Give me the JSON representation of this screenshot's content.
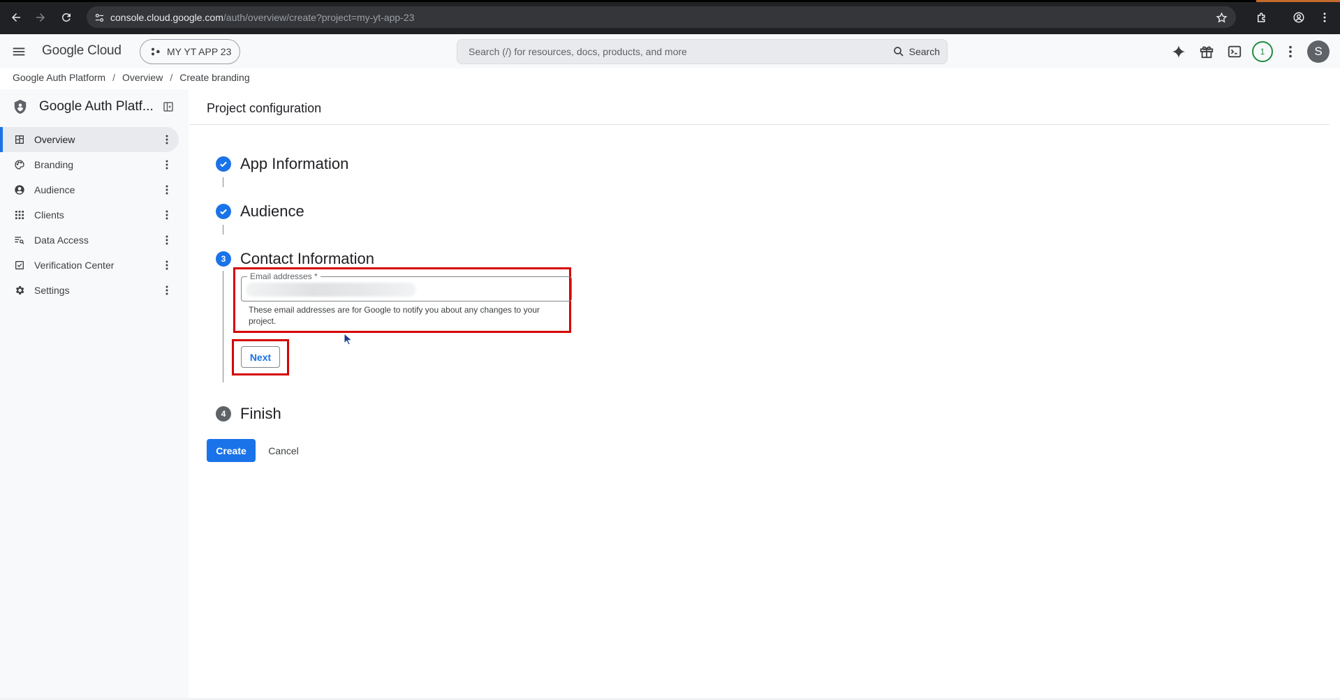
{
  "browser": {
    "url_host": "console.cloud.google.com",
    "url_path": "/auth/overview/create?project=my-yt-app-23"
  },
  "header": {
    "logo": "Google Cloud",
    "project": "MY YT APP 23",
    "search_placeholder": "Search (/) for resources, docs, products, and more",
    "search_button": "Search",
    "notification_count": "1",
    "avatar_initial": "S"
  },
  "breadcrumb": [
    "Google Auth Platform",
    "Overview",
    "Create branding"
  ],
  "sidebar": {
    "product_title": "Google Auth Platf...",
    "items": [
      {
        "label": "Overview",
        "icon": "dashboard-icon",
        "active": true
      },
      {
        "label": "Branding",
        "icon": "palette-icon"
      },
      {
        "label": "Audience",
        "icon": "account-circle-icon"
      },
      {
        "label": "Clients",
        "icon": "apps-grid-icon"
      },
      {
        "label": "Data Access",
        "icon": "data-access-icon"
      },
      {
        "label": "Verification Center",
        "icon": "verification-icon"
      },
      {
        "label": "Settings",
        "icon": "gear-icon"
      }
    ]
  },
  "main": {
    "title": "Project configuration",
    "steps": [
      {
        "number": "1",
        "title": "App Information",
        "state": "done"
      },
      {
        "number": "2",
        "title": "Audience",
        "state": "done"
      },
      {
        "number": "3",
        "title": "Contact Information",
        "state": "current"
      },
      {
        "number": "4",
        "title": "Finish",
        "state": "pending"
      }
    ],
    "email_field": {
      "label": "Email addresses *",
      "helper": "These email addresses are for Google to notify you about any changes to your project."
    },
    "next_button": "Next",
    "create_button": "Create",
    "cancel_button": "Cancel"
  },
  "colors": {
    "accent": "#1a73e8",
    "highlight": "#d50000",
    "chrome_bg": "#202124",
    "console_bg": "#f8f9fa"
  }
}
